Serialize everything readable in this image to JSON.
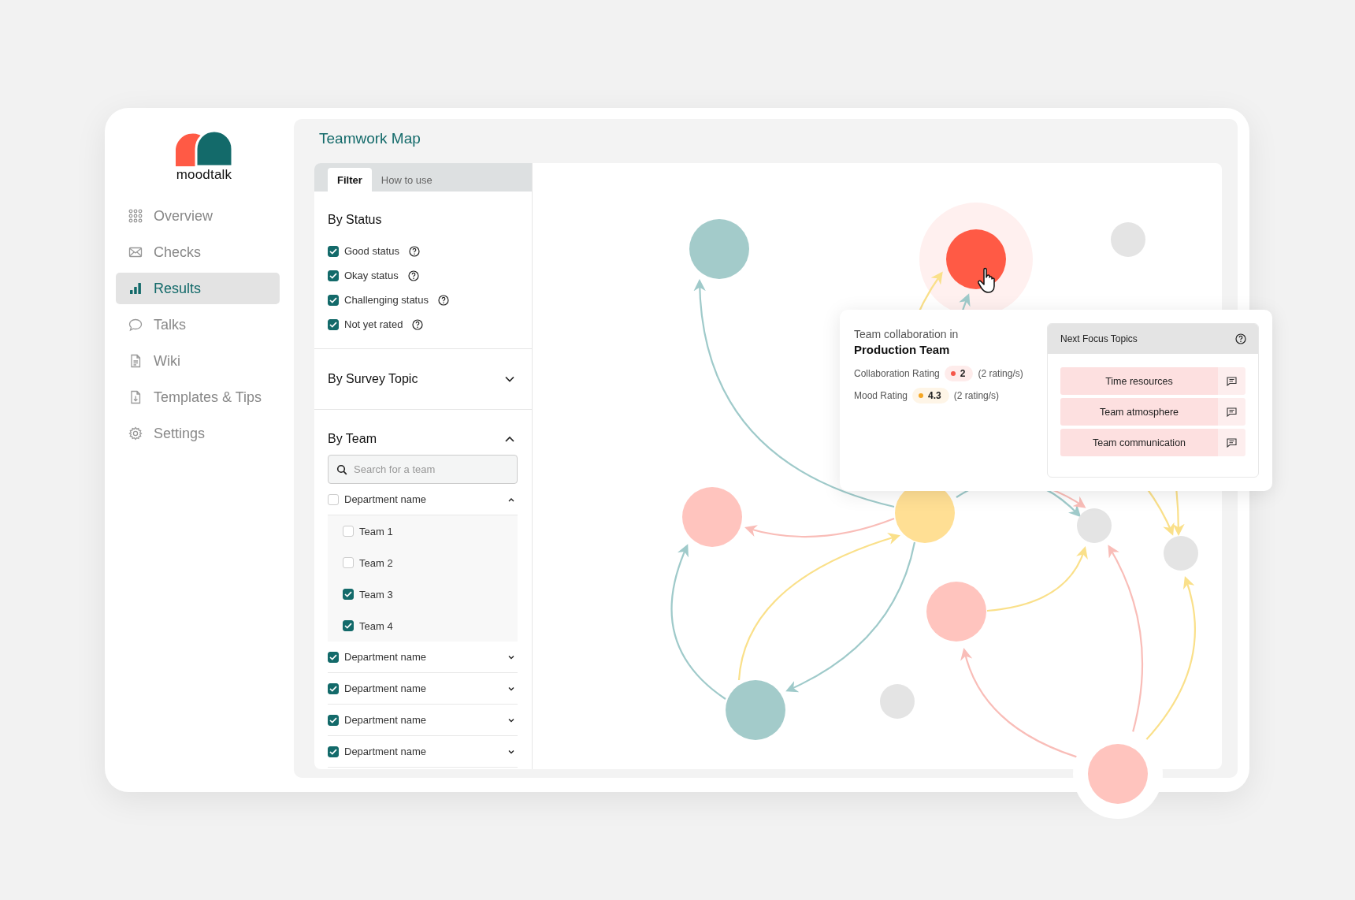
{
  "logo": {
    "text": "moodtalk"
  },
  "nav": [
    {
      "label": "Overview",
      "kind": "grid",
      "selected": false
    },
    {
      "label": "Checks",
      "kind": "mail",
      "selected": false
    },
    {
      "label": "Results",
      "kind": "chart",
      "selected": true
    },
    {
      "label": "Talks",
      "kind": "chat",
      "selected": false
    },
    {
      "label": "Wiki",
      "kind": "doc",
      "selected": false
    },
    {
      "label": "Templates & Tips",
      "kind": "download",
      "selected": false
    },
    {
      "label": "Settings",
      "kind": "gear",
      "selected": false
    }
  ],
  "page": {
    "title": "Teamwork Map"
  },
  "filter": {
    "tabs": [
      {
        "label": "Filter",
        "selected": true
      },
      {
        "label": "How to use",
        "selected": false
      }
    ],
    "status": {
      "title": "By Status",
      "options": [
        {
          "label": "Good status",
          "checked": true
        },
        {
          "label": "Okay status",
          "checked": true
        },
        {
          "label": "Challenging status",
          "checked": true
        },
        {
          "label": "Not yet rated",
          "checked": true
        }
      ]
    },
    "survey_topic": {
      "title": "By Survey Topic",
      "expanded": false
    },
    "team": {
      "title": "By Team",
      "expanded": true,
      "search": {
        "placeholder": "Search for a team"
      },
      "departments": [
        {
          "label": "Department name",
          "checked": false,
          "expanded": true,
          "teams": [
            {
              "label": "Team 1",
              "checked": false
            },
            {
              "label": "Team 2",
              "checked": false
            },
            {
              "label": "Team 3",
              "checked": true
            },
            {
              "label": "Team 4",
              "checked": true
            }
          ]
        },
        {
          "label": "Department name",
          "checked": true,
          "expanded": false
        },
        {
          "label": "Department name",
          "checked": true,
          "expanded": false
        },
        {
          "label": "Department name",
          "checked": true,
          "expanded": false
        },
        {
          "label": "Department name",
          "checked": true,
          "expanded": false
        }
      ]
    }
  },
  "tooltip": {
    "subtitle": "Team collaboration in",
    "team": "Production Team",
    "ratings": [
      {
        "label": "Collaboration Rating",
        "value": "2",
        "color": "#f5564a",
        "count": "(2 rating/s)"
      },
      {
        "label": "Mood Rating",
        "value": "4.3",
        "color": "#f5a623",
        "count": "(2 rating/s)"
      }
    ],
    "focus": {
      "title": "Next Focus Topics",
      "topics": [
        "Time resources",
        "Team atmosphere",
        "Team communication"
      ]
    }
  }
}
